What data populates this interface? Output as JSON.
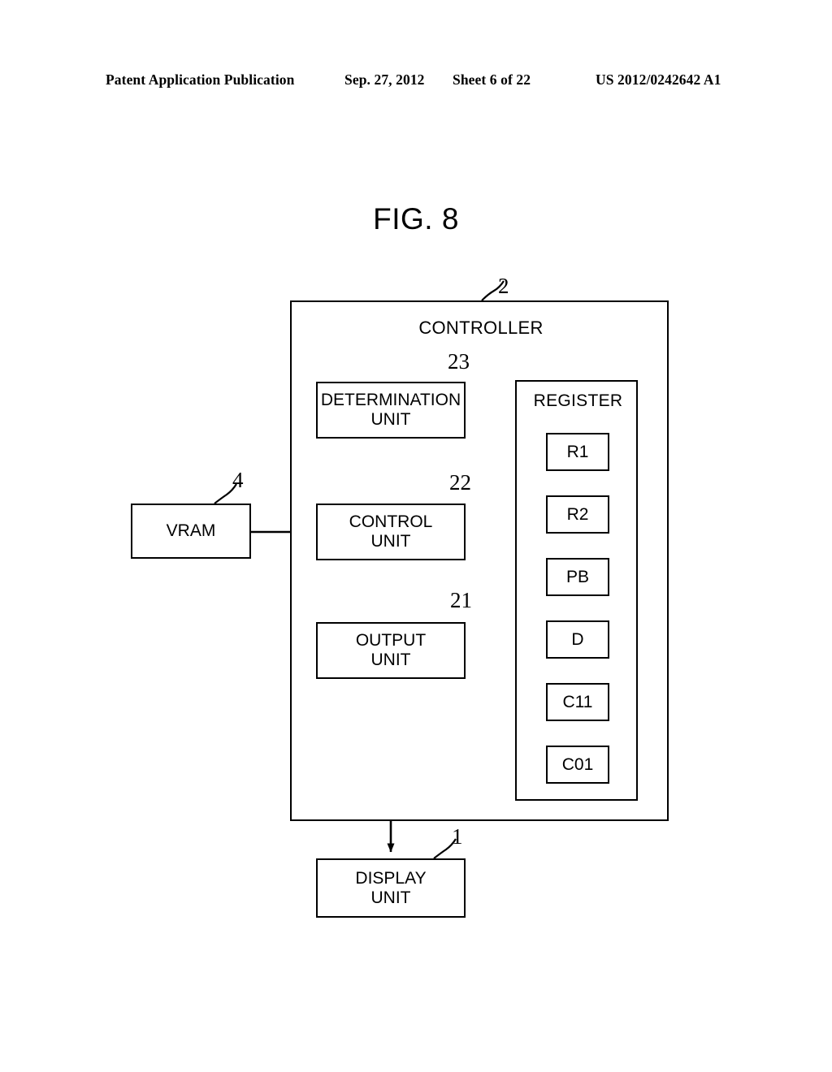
{
  "header": {
    "left": "Patent Application Publication",
    "date": "Sep. 27, 2012",
    "sheet": "Sheet 6 of 22",
    "number": "US 2012/0242642 A1"
  },
  "figure": {
    "title": "FIG. 8"
  },
  "diagram": {
    "controller": {
      "label": "CONTROLLER",
      "ref": "2"
    },
    "determination_unit": {
      "label_line1": "DETERMINATION",
      "label_line2": "UNIT",
      "ref": "23"
    },
    "control_unit": {
      "label_line1": "CONTROL",
      "label_line2": "UNIT",
      "ref": "22"
    },
    "output_unit": {
      "label_line1": "OUTPUT",
      "label_line2": "UNIT",
      "ref": "21"
    },
    "display_unit": {
      "label_line1": "DISPLAY",
      "label_line2": "UNIT",
      "ref": "1"
    },
    "vram": {
      "label": "VRAM",
      "ref": "4"
    },
    "register": {
      "label": "REGISTER",
      "cells": [
        {
          "label": "R1"
        },
        {
          "label": "R2"
        },
        {
          "label": "PB"
        },
        {
          "label": "D"
        },
        {
          "label": "C11"
        },
        {
          "label": "C01"
        }
      ]
    },
    "connections": [
      {
        "from": "vram",
        "to": "control_unit",
        "direction": "right"
      },
      {
        "from": "register",
        "to": "determination_unit",
        "direction": "left"
      },
      {
        "from": "control_unit",
        "to": "register",
        "direction": "right"
      },
      {
        "from": "determination_unit",
        "to": "control_unit",
        "direction": "down"
      },
      {
        "from": "control_unit",
        "to": "output_unit",
        "direction": "down"
      },
      {
        "from": "output_unit",
        "to": "display_unit",
        "direction": "down"
      }
    ]
  },
  "colors": {
    "ink": "#000000",
    "paper": "#ffffff"
  }
}
